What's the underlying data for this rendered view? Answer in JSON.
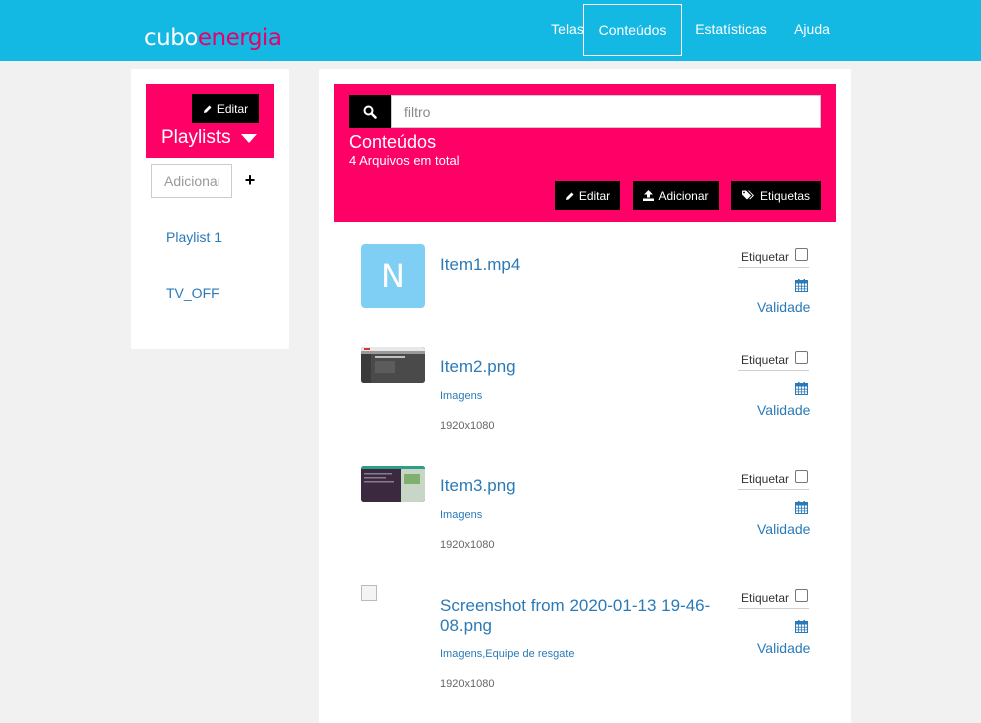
{
  "brand": {
    "part1": "cubo",
    "part2": "energia"
  },
  "nav": [
    {
      "label": "Telas",
      "active": false
    },
    {
      "label": "Conteúdos",
      "active": true
    },
    {
      "label": "Estatísticas",
      "active": false
    },
    {
      "label": "Ajuda",
      "active": false
    }
  ],
  "sidebar": {
    "edit_label": "Editar",
    "title": "Playlists",
    "add_placeholder": "Adicionar",
    "add_icon": "+",
    "items": [
      {
        "label": "Playlist 1"
      },
      {
        "label": "TV_OFF"
      }
    ]
  },
  "content": {
    "search_placeholder": "filtro",
    "title": "Conteúdos",
    "count_text": "4 Arquivos em total",
    "edit_label": "Editar",
    "add_label": "Adicionar",
    "tags_label": "Etiquetas",
    "items": [
      {
        "name": "Item1.mp4",
        "thumb_letter": "N",
        "tags": "",
        "resolution": "",
        "tag_label": "Etiquetar",
        "validity_label": "Validade"
      },
      {
        "name": "Item2.png",
        "tags": "Imagens",
        "resolution": "1920x1080",
        "tag_label": "Etiquetar",
        "validity_label": "Validade"
      },
      {
        "name": "Item3.png",
        "tags": "Imagens",
        "resolution": "1920x1080",
        "tag_label": "Etiquetar",
        "validity_label": "Validade"
      },
      {
        "name": "Screenshot from 2020-01-13 19-46-08.png",
        "tags": "Imagens,Equipe de resgate",
        "resolution": "1920x1080",
        "tag_label": "Etiquetar",
        "validity_label": "Validade"
      }
    ]
  },
  "colors": {
    "topbar": "#13b8e3",
    "accent": "#ff0066",
    "link": "#2a7ab8",
    "thumb": "#7fcff4"
  }
}
